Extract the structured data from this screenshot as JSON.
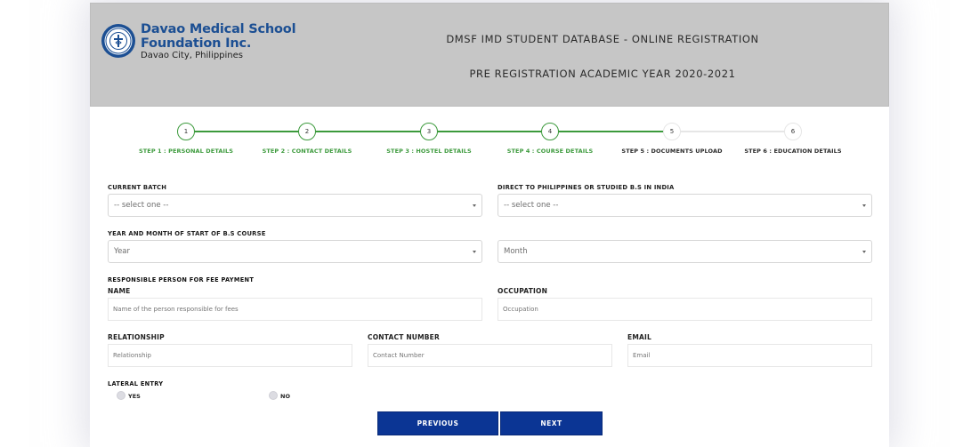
{
  "header": {
    "brand_line1": "Davao Medical School",
    "brand_line2": "Foundation Inc.",
    "brand_sub": "Davao City, Philippines",
    "logo_icon": "seal-logo-icon",
    "title": "DMSF IMD STUDENT DATABASE - ONLINE REGISTRATION",
    "subtitle": "PRE REGISTRATION ACADEMIC YEAR 2020-2021"
  },
  "colors": {
    "accent_green": "#3c9a3c",
    "brand_blue": "#1c4f93",
    "button_blue": "#0b3594",
    "header_gray": "#c6c6c6"
  },
  "stepper": {
    "current_step": 4,
    "steps": [
      {
        "number": "1",
        "label": "STEP 1 : PERSONAL DETAILS",
        "status": "done"
      },
      {
        "number": "2",
        "label": "STEP 2 : CONTACT DETAILS",
        "status": "done"
      },
      {
        "number": "3",
        "label": "STEP 3 : HOSTEL DETAILS",
        "status": "done"
      },
      {
        "number": "4",
        "label": "STEP 4 : COURSE DETAILS",
        "status": "done"
      },
      {
        "number": "5",
        "label": "STEP 5 : DOCUMENTS UPLOAD",
        "status": "todo"
      },
      {
        "number": "6",
        "label": "STEP 6 : EDUCATION DETAILS",
        "status": "todo"
      }
    ]
  },
  "form": {
    "current_batch": {
      "label": "CURRENT BATCH",
      "value": "-- select one --"
    },
    "direct_or_bs": {
      "label": "DIRECT TO PHILIPPINES OR STUDIED B.S IN INDIA",
      "value": "-- select one --"
    },
    "bs_start": {
      "label": "YEAR AND MONTH OF START OF B.S COURSE",
      "year_value": "Year",
      "month_value": "Month"
    },
    "fee_section_label": "RESPONSIBLE PERSON FOR FEE PAYMENT",
    "name": {
      "label": "NAME",
      "placeholder": "Name of the person responsible for fees",
      "value": ""
    },
    "occupation": {
      "label": "OCCUPATION",
      "placeholder": "Occupation",
      "value": ""
    },
    "relationship": {
      "label": "RELATIONSHIP",
      "placeholder": "Relationship",
      "value": ""
    },
    "contact_number": {
      "label": "CONTACT NUMBER",
      "placeholder": "Contact Number",
      "value": ""
    },
    "email": {
      "label": "EMAIL",
      "placeholder": "Email",
      "value": ""
    },
    "lateral_entry": {
      "label": "LATERAL ENTRY",
      "options": [
        "YES",
        "NO"
      ],
      "selected": null
    }
  },
  "buttons": {
    "previous": "PREVIOUS",
    "next": "NEXT"
  }
}
